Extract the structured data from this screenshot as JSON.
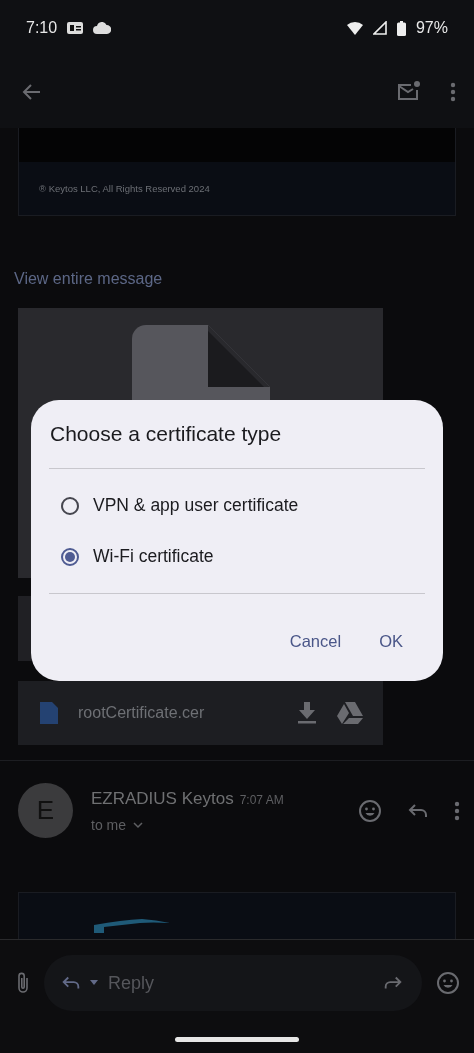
{
  "status_bar": {
    "time": "7:10",
    "battery": "97%"
  },
  "email_footer": {
    "copyright": "® Keytos LLC, All Rights Reserved 2024"
  },
  "view_entire_message": "View entire message",
  "attachment": {
    "file_name": "rootCertificate.cer"
  },
  "message": {
    "avatar_letter": "E",
    "sender": "EZRADIUS Keytos",
    "time": "7:07 AM",
    "recipient": "to me"
  },
  "reply_bar": {
    "placeholder": "Reply"
  },
  "dialog": {
    "title": "Choose a certificate type",
    "options": [
      {
        "label": "VPN & app user certificate",
        "selected": false
      },
      {
        "label": "Wi-Fi certificate",
        "selected": true
      }
    ],
    "buttons": [
      {
        "label": "Cancel"
      },
      {
        "label": "OK"
      }
    ]
  }
}
